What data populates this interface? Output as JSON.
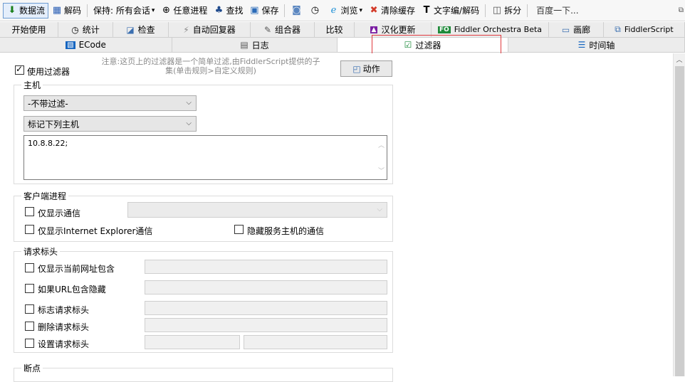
{
  "toolbar": {
    "items": [
      {
        "label": "数据流",
        "icon": "down-arrow-icon",
        "glyph": "⬇",
        "color": "#1a7f1a"
      },
      {
        "label": "解码",
        "icon": "barcode-icon",
        "glyph": "▦",
        "color": "#2b5fb5"
      },
      {
        "label": "保持: 所有会话",
        "dropdown": true
      },
      {
        "label": "任意进程",
        "icon": "crosshair-icon",
        "glyph": "⊕",
        "color": "#222"
      },
      {
        "label": "查找",
        "icon": "binoculars-icon",
        "glyph": "♣",
        "color": "#1f4a8c"
      },
      {
        "label": "保存",
        "icon": "save-icon",
        "glyph": "▣",
        "color": "#2a6ab8"
      },
      {
        "icon": "camera-icon",
        "glyph": "◙",
        "color": "#5a86c0"
      },
      {
        "icon": "timer-icon",
        "glyph": "◷",
        "color": "#333"
      },
      {
        "label": "浏览",
        "icon": "ie-icon",
        "glyph": "ℯ",
        "color": "#1d8fd6",
        "dropdown": true
      },
      {
        "label": "清除缓存",
        "icon": "clear-cache-icon",
        "glyph": "✖",
        "color": "#d33b2a"
      },
      {
        "label": "文字编/解码",
        "icon": "text-encode-icon",
        "glyph": "T",
        "color": "#222"
      },
      {
        "label": "拆分",
        "icon": "split-icon",
        "glyph": "◫",
        "color": "#555"
      },
      {
        "label": "百度一下..."
      }
    ]
  },
  "tabs_row1": [
    {
      "label": "开始使用",
      "icon": ""
    },
    {
      "label": "统计",
      "icon": "stopwatch-icon",
      "glyph": "◷"
    },
    {
      "label": "检查",
      "icon": "inspect-icon",
      "glyph": "◪"
    },
    {
      "label": "自动回复器",
      "icon": "bolt-icon",
      "glyph": "⚡"
    },
    {
      "label": "组合器",
      "icon": "compose-icon",
      "glyph": "✎"
    },
    {
      "label": "比较",
      "icon": ""
    },
    {
      "label": "汉化更新",
      "icon": "update-icon",
      "glyph": "▲"
    },
    {
      "label": "Fiddler Orchestra Beta",
      "icon": "fo-icon",
      "glyph": "FO"
    },
    {
      "label": "画廊",
      "icon": "gallery-icon",
      "glyph": "▭"
    },
    {
      "label": "FiddlerScript",
      "icon": "script-icon",
      "glyph": "⧉"
    }
  ],
  "tabs_row2": [
    {
      "label": "ECode",
      "icon": "ecode-icon",
      "glyph": "▧"
    },
    {
      "label": "日志",
      "icon": "log-icon",
      "glyph": "▤"
    },
    {
      "label": "过滤器",
      "icon": "checkbox-icon",
      "glyph": "☑",
      "active": true
    },
    {
      "label": "时间轴",
      "icon": "timeline-icon",
      "glyph": "☰"
    }
  ],
  "filters": {
    "use_filters_label": "使用过滤器",
    "use_filters_checked": true,
    "note_line1": "注意:这页上的过滤器是一个简单过滤,由FiddlerScript提供的子",
    "note_line2": "集(单击规则>自定义规则)",
    "action_label": "动作"
  },
  "hosts": {
    "title": "主机",
    "zone_select": "-不带过滤-",
    "host_select": "标记下列主机",
    "host_list": "10.8.8.22;"
  },
  "client_process": {
    "title": "客户端进程",
    "show_only_traffic": "仅显示通信",
    "show_only_ie": "仅显示Internet Explorer通信",
    "hide_service_host": "隐藏服务主机的通信"
  },
  "request_headers": {
    "title": "请求标头",
    "url_contains": "仅显示当前网址包含",
    "hide_if_url": "如果URL包含隐藏",
    "flag_header": "标志请求标头",
    "delete_header": "删除请求标头",
    "set_header": "设置请求标头"
  },
  "breakpoints": {
    "title": "断点"
  }
}
